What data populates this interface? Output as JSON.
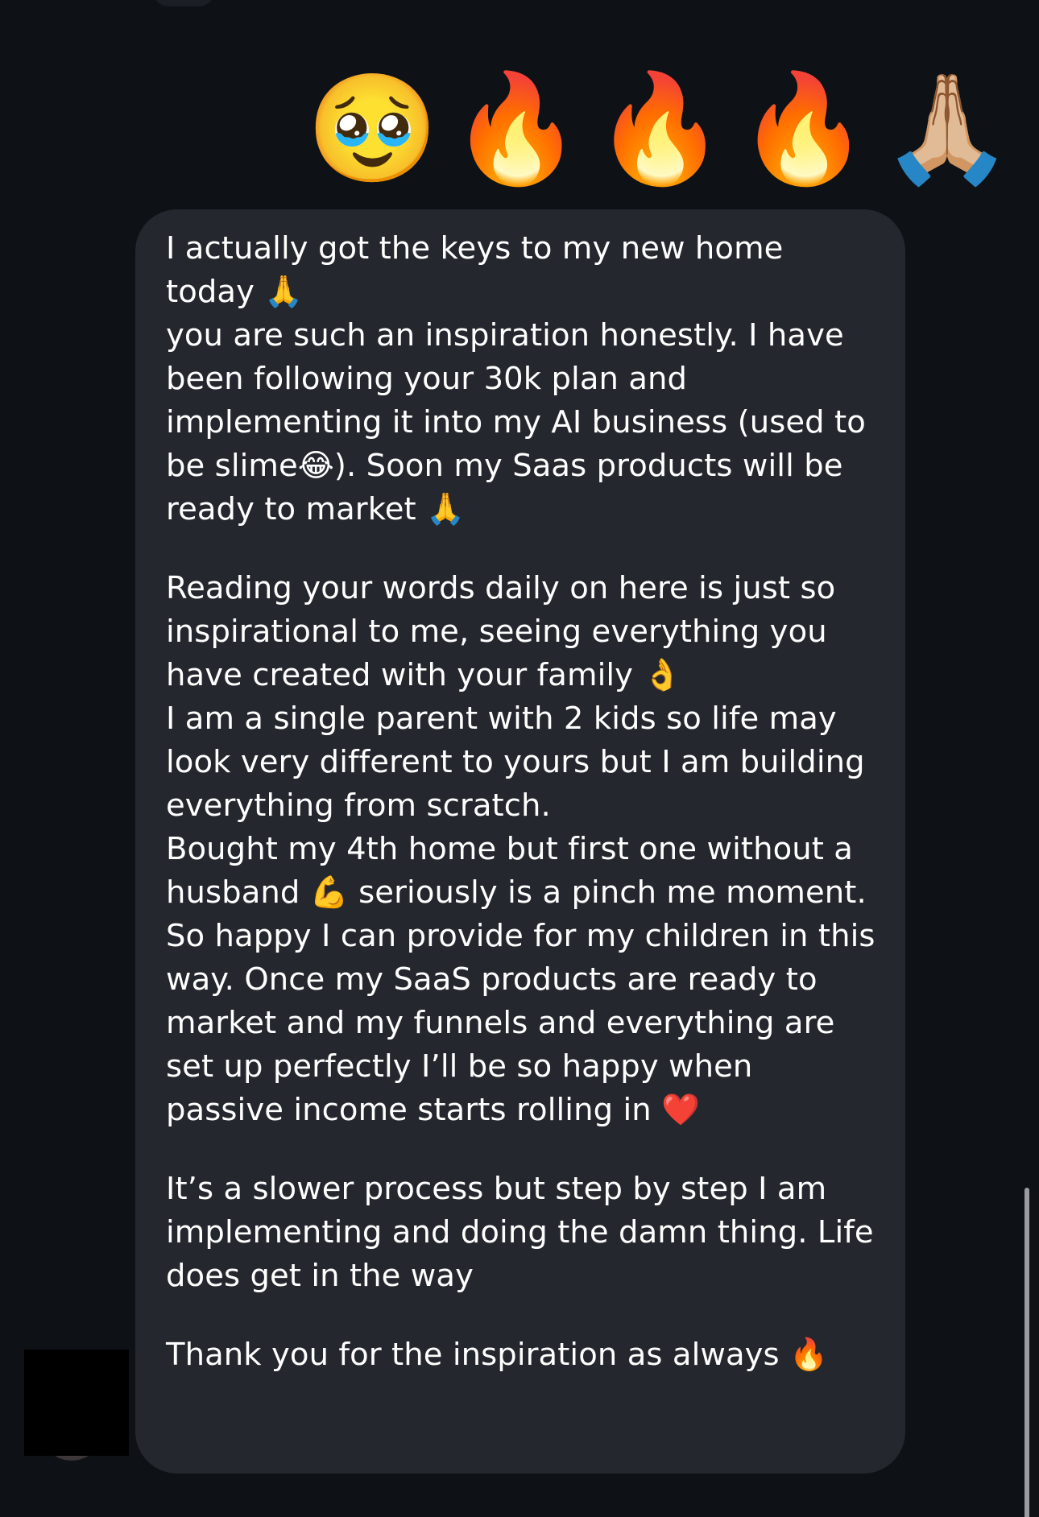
{
  "reaction_emojis": [
    {
      "char": "🥹",
      "icon": "pleading-face-icon"
    },
    {
      "char": "🔥",
      "icon": "fire-icon"
    },
    {
      "char": "🔥",
      "icon": "fire-icon"
    },
    {
      "char": "🔥",
      "icon": "fire-icon"
    },
    {
      "char": "🙏🏼",
      "icon": "folded-hands-icon"
    }
  ],
  "message": {
    "paragraphs": [
      "I actually got the keys to my new home today 🙏\nyou are such an inspiration honestly. I have been following your 30k plan and implementing it into my AI business (used to be slime😂). Soon my Saas products will be ready to market 🙏",
      "Reading your words daily on here is just so inspirational to me, seeing everything you have created with your family 👌\nI am a single parent with 2 kids so life may look very different to yours but I am building everything from scratch.\nBought my 4th home but first one without a husband 💪 seriously is a pinch me moment. So happy I can provide for my children in this way. Once my SaaS products are ready to market and my funnels and everything are set up perfectly I’ll be so happy when passive income starts rolling in ❤️",
      "It’s a slower process but step by step I am implementing and doing the damn thing. Life does get in the way",
      "Thank you for the inspiration as always 🔥"
    ]
  },
  "colors": {
    "background": "#0e1217",
    "bubble": "#24272d",
    "text": "#ffffff"
  }
}
